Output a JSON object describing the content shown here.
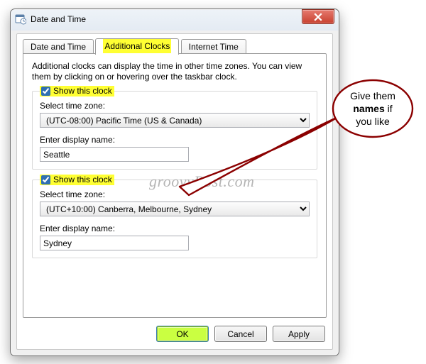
{
  "window": {
    "title": "Date and Time"
  },
  "tabs": {
    "date_time": "Date and Time",
    "additional_clocks": "Additional Clocks",
    "internet_time": "Internet Time"
  },
  "description": "Additional clocks can display the time in other time zones. You can view them by clicking on or hovering over the taskbar clock.",
  "clock1": {
    "show_label": "Show this clock",
    "tz_label": "Select time zone:",
    "tz_value": "(UTC-08:00) Pacific Time (US & Canada)",
    "name_label": "Enter display name:",
    "name_value": "Seattle"
  },
  "clock2": {
    "show_label": "Show this clock",
    "tz_label": "Select time zone:",
    "tz_value": "(UTC+10:00) Canberra, Melbourne, Sydney",
    "name_label": "Enter display name:",
    "name_value": "Sydney"
  },
  "buttons": {
    "ok": "OK",
    "cancel": "Cancel",
    "apply": "Apply"
  },
  "annotation": {
    "line1": "Give them",
    "line2_bold": "names",
    "line2_rest": " if",
    "line3": "you like"
  },
  "watermark": "groovyPost.com",
  "colors": {
    "highlight": "#ffff33",
    "annotation_stroke": "#8b0000"
  }
}
